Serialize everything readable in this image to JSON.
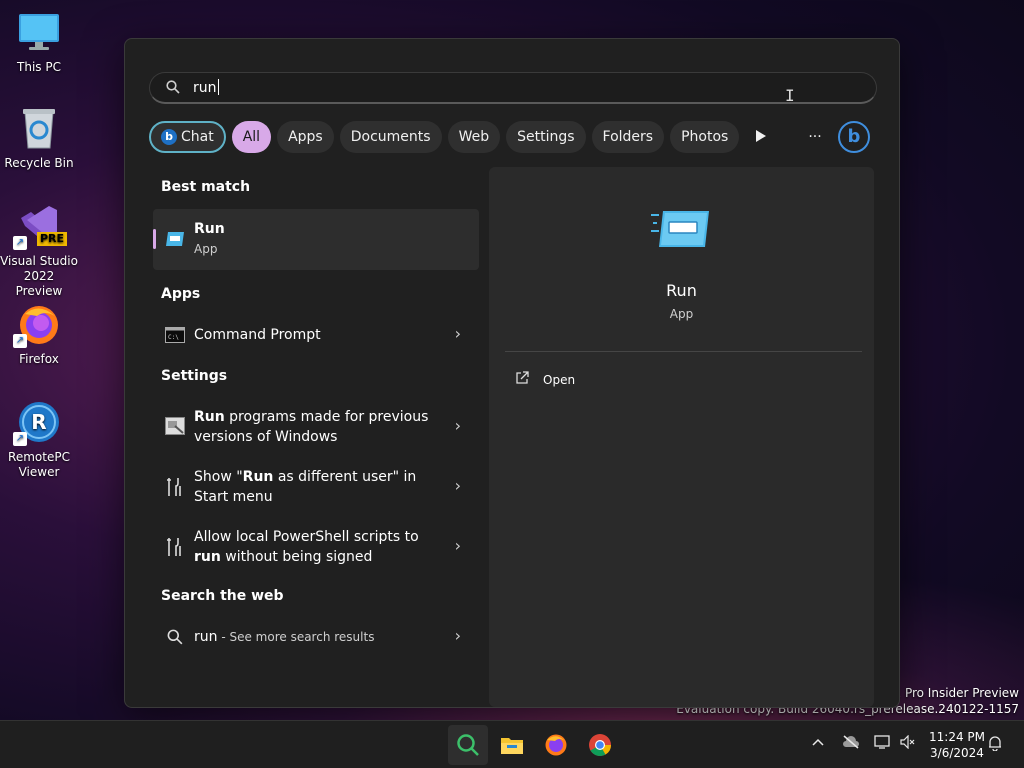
{
  "desktop": {
    "icons": [
      {
        "label": "This PC"
      },
      {
        "label": "Recycle Bin"
      },
      {
        "label": "Visual Studio 2022 Preview",
        "badge": "PRE"
      },
      {
        "label": "Firefox"
      },
      {
        "label": "RemotePC Viewer",
        "glyph": "R"
      }
    ],
    "watermark": {
      "line1": "s 11 Pro Insider Preview",
      "line2": "Evaluation copy. Build 26040.rs_prerelease.240122-1157"
    }
  },
  "search": {
    "query": "run"
  },
  "filters": {
    "chat": "Chat",
    "all": "All",
    "apps": "Apps",
    "documents": "Documents",
    "web": "Web",
    "settings": "Settings",
    "folders": "Folders",
    "photos": "Photos",
    "more": "···",
    "bing_letter": "b"
  },
  "results": {
    "best_match_title": "Best match",
    "best_match": {
      "name": "Run",
      "type": "App"
    },
    "apps_title": "Apps",
    "apps": [
      {
        "name": "Command Prompt"
      }
    ],
    "settings_title": "Settings",
    "settings": [
      {
        "bold": "Run",
        "rest": " programs made for previous",
        "line2": "versions of Windows"
      },
      {
        "pre": "Show \"",
        "bold": "Run",
        "post": " as different user\" in",
        "line2": "Start menu"
      },
      {
        "line1": "Allow local PowerShell scripts to",
        "bold": "run",
        "post": " without being signed"
      }
    ],
    "web_title": "Search the web",
    "web": {
      "query": "run",
      "suffix": " - See more search results"
    }
  },
  "preview": {
    "name": "Run",
    "type": "App",
    "action_open": "Open"
  },
  "taskbar": {
    "time": "11:24 PM",
    "date": "3/6/2024"
  },
  "colors": {
    "accent": "#d8a9e8",
    "panel": "#202020",
    "chat_border": "#5fb2c7",
    "bing": "#3f8ede"
  }
}
